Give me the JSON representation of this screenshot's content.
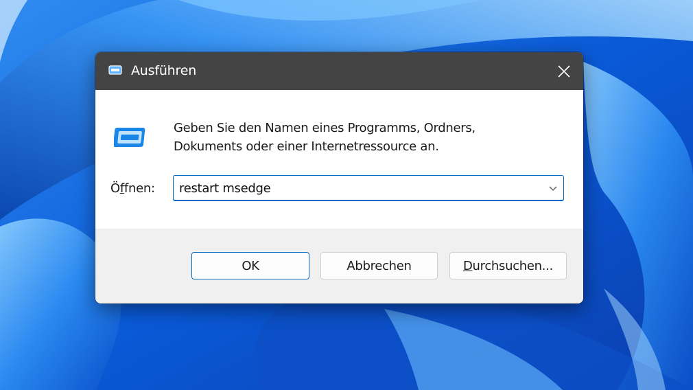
{
  "dialog": {
    "title": "Ausführen",
    "message_line1": "Geben Sie den Namen eines Programms, Ordners,",
    "message_line2": "Dokuments oder einer Internetressource an.",
    "open_label_pre": "Ö",
    "open_label_accel": "f",
    "open_label_post": "fnen:",
    "command_value": "restart msedge",
    "buttons": {
      "ok": "OK",
      "cancel": "Abbrechen",
      "browse_accel": "D",
      "browse_rest": "urchsuchen..."
    }
  },
  "colors": {
    "titlebar": "#444444",
    "accent": "#0067c0",
    "footer": "#f0f0f0"
  },
  "icons": {
    "title": "run-icon",
    "close": "close-icon",
    "dialog": "run-icon",
    "dropdown": "chevron-down-icon"
  }
}
